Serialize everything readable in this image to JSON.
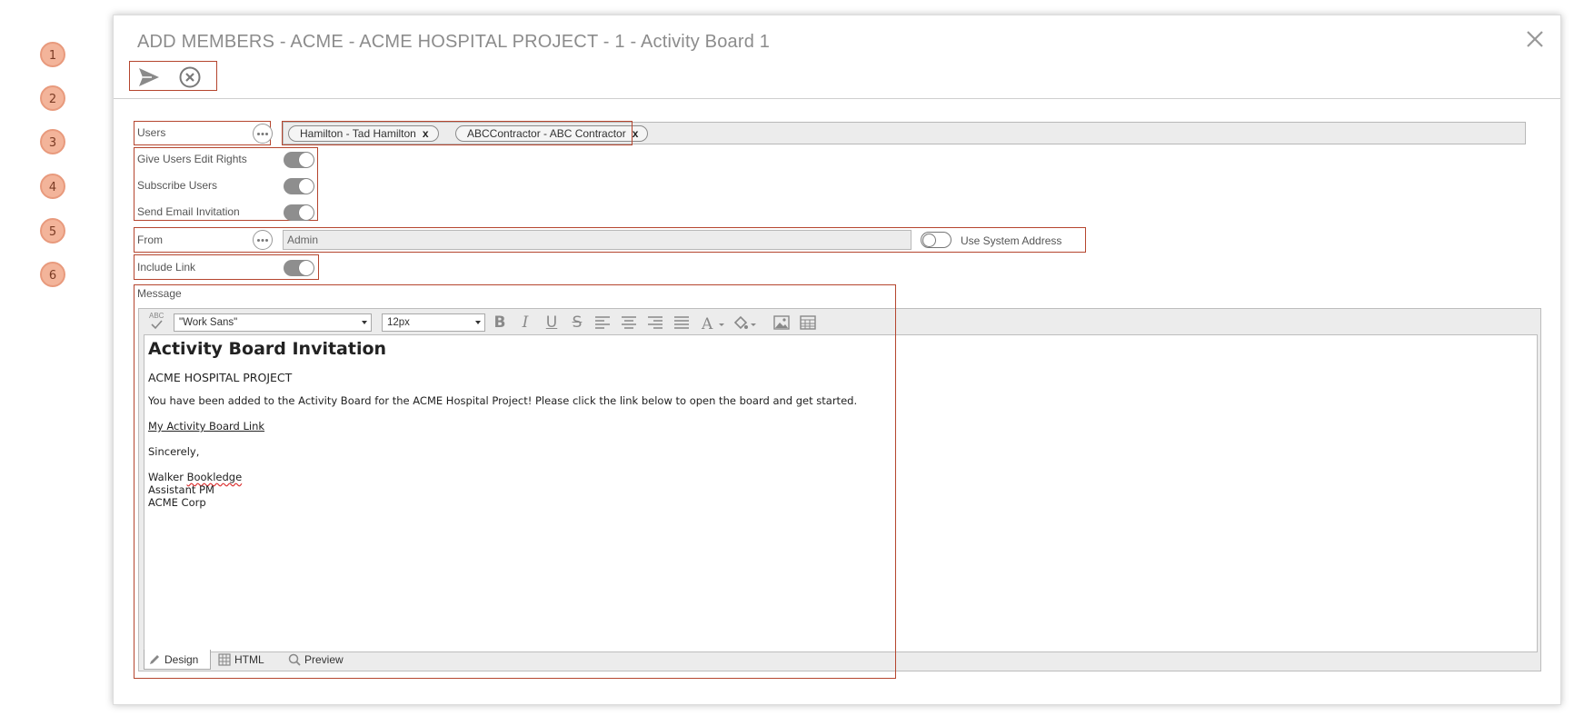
{
  "callouts": [
    "1",
    "2",
    "3",
    "4",
    "5",
    "6"
  ],
  "dialog": {
    "title": "ADD MEMBERS - ACME - ACME HOSPITAL PROJECT - 1 - Activity Board 1"
  },
  "toolbar": {
    "send_icon": "send-icon",
    "cancel_icon": "cancel-circle-icon"
  },
  "users": {
    "label": "Users",
    "chips": [
      "Hamilton - Tad Hamilton",
      "ABCContractor - ABC Contractor"
    ],
    "chip_remove": "x"
  },
  "options": {
    "edit_rights": {
      "label": "Give Users Edit Rights",
      "on": true
    },
    "subscribe": {
      "label": "Subscribe Users",
      "on": true
    },
    "send_email": {
      "label": "Send Email Invitation",
      "on": true
    }
  },
  "from": {
    "label": "From",
    "value": "Admin",
    "system_label": "Use System Address",
    "system_on": false
  },
  "include_link": {
    "label": "Include Link",
    "on": true
  },
  "message": {
    "label": "Message",
    "font": "\"Work Sans\"",
    "size": "12px",
    "spell_label": "ABC",
    "heading": "Activity Board Invitation",
    "project": "ACME HOSPITAL PROJECT",
    "body": "You have been added to the Activity Board for the ACME Hospital Project! Please click the link below to open the board and get started.",
    "link": "My Activity Board Link",
    "closing": "Sincerely,",
    "sig_first": "Walker",
    "sig_last": "Bookledge",
    "sig_title": "Assistant PM",
    "sig_company": "ACME Corp",
    "tabs": [
      "Design",
      "HTML",
      "Preview"
    ],
    "active_tab": "Design"
  },
  "colors": {
    "highlight": "#b5452e",
    "callout": "#f3b49a",
    "toggle_on": "#8e8e8e"
  }
}
